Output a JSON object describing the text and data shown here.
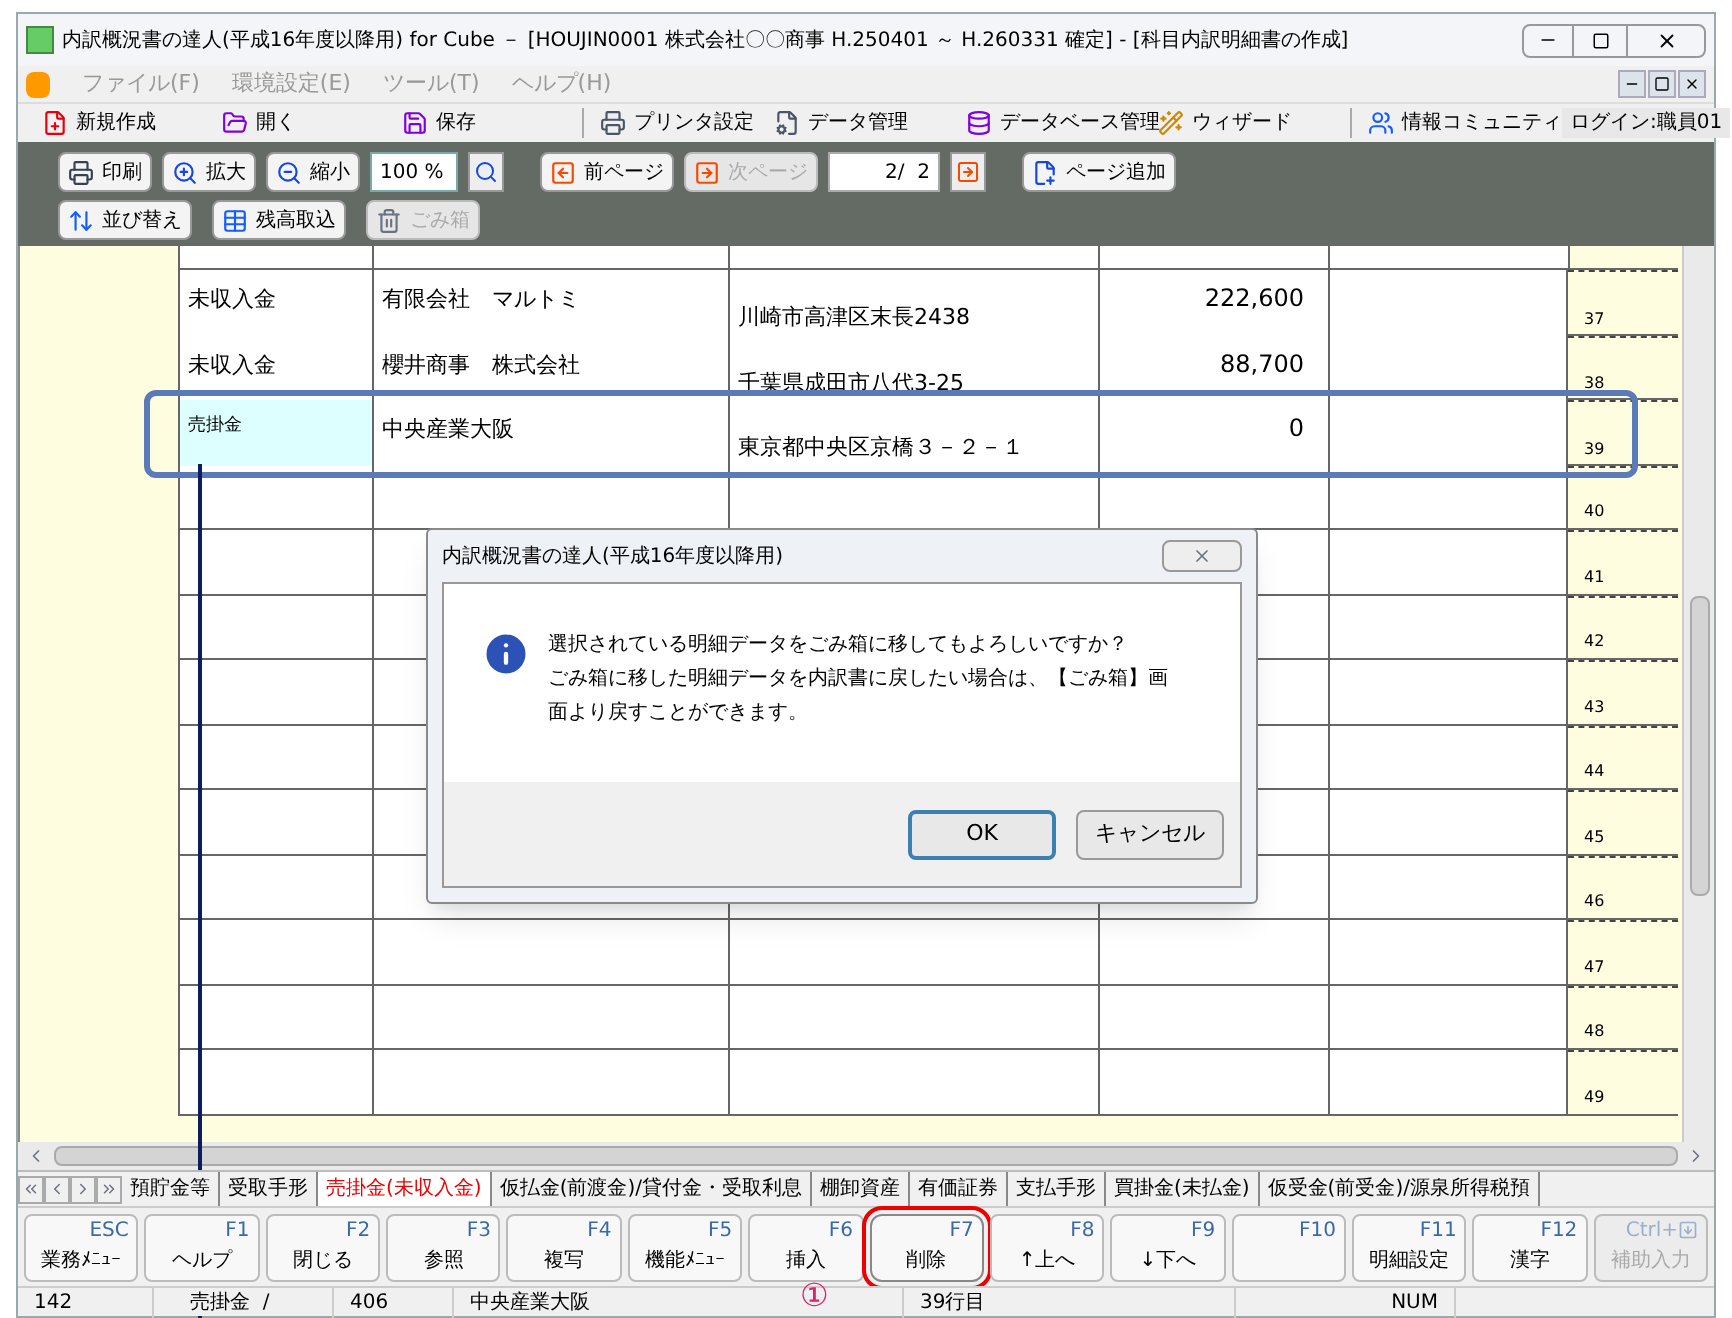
{
  "window": {
    "title": "内訳概況書の達人(平成16年度以降用) for Cube － [HOUJIN0001 株式会社〇〇商事 H.250401 ～ H.260331 確定] - [科目内訳明細書の作成]"
  },
  "menu": [
    "ファイル(F)",
    "環境設定(E)",
    "ツール(T)",
    "ヘルプ(H)"
  ],
  "toolbar": [
    {
      "label": "新規作成",
      "kind": "new"
    },
    {
      "label": "開く",
      "kind": "open"
    },
    {
      "label": "保存",
      "kind": "save"
    },
    {
      "label": "プリンタ設定",
      "kind": "printer"
    },
    {
      "label": "データ管理",
      "kind": "data"
    },
    {
      "label": "データベース管理",
      "kind": "database"
    },
    {
      "label": "ウィザード",
      "kind": "wizard"
    },
    {
      "label": "情報コミュニティ",
      "kind": "community"
    }
  ],
  "login": "ログイン:職員01",
  "preview_toolbar": {
    "row1": [
      {
        "label": "印刷",
        "kind": "print",
        "disabled": false
      },
      {
        "label": "拡大",
        "kind": "zoomin",
        "disabled": false
      },
      {
        "label": "縮小",
        "kind": "zoomout",
        "disabled": false
      }
    ],
    "zoom_value": "100 %",
    "page_buttons": [
      {
        "label": "前ページ",
        "kind": "prev",
        "disabled": false
      },
      {
        "label": "次ページ",
        "kind": "next",
        "disabled": true
      }
    ],
    "page_value": "2/  2",
    "add_page": "ページ追加",
    "row2": [
      {
        "label": "並び替え",
        "kind": "sort",
        "disabled": false
      },
      {
        "label": "残高取込",
        "kind": "import",
        "disabled": false
      },
      {
        "label": "ごみ箱",
        "kind": "trash",
        "disabled": true
      }
    ]
  },
  "table": {
    "rows": [
      {
        "number": "37",
        "account": "未収入金",
        "name": "有限会社　マルトミ",
        "address": "川崎市高津区末長2438",
        "amount": "222,600",
        "selected": false
      },
      {
        "number": "38",
        "account": "未収入金",
        "name": "櫻井商事　株式会社",
        "address": "千葉県成田市八代3-25",
        "amount": "88,700",
        "selected": false
      },
      {
        "number": "39",
        "account": "売掛金",
        "name": "中央産業大阪",
        "address": "東京都中央区京橋３－２－１",
        "amount": "0",
        "selected": true
      },
      {
        "number": "40"
      },
      {
        "number": "41"
      },
      {
        "number": "42"
      },
      {
        "number": "43"
      },
      {
        "number": "44"
      },
      {
        "number": "45"
      },
      {
        "number": "46"
      },
      {
        "number": "47"
      },
      {
        "number": "48"
      },
      {
        "number": "49"
      }
    ]
  },
  "dialog": {
    "title": "内訳概況書の達人(平成16年度以降用)",
    "message": [
      "選択されている明細データをごみ箱に移してもよろしいですか？",
      "ごみ箱に移した明細データを内訳書に戻したい場合は、【ごみ箱】画",
      "面より戻すことができます。"
    ],
    "buttons": [
      {
        "label": "OK",
        "selected": true
      },
      {
        "label": "キャンセル",
        "selected": false
      }
    ]
  },
  "sheet_tabs": [
    {
      "label": "預貯金等",
      "selected": false
    },
    {
      "label": "受取手形",
      "selected": false
    },
    {
      "label": "売掛金(未収入金)",
      "selected": true
    },
    {
      "label": "仮払金(前渡金)/貸付金・受取利息",
      "selected": false
    },
    {
      "label": "棚卸資産",
      "selected": false
    },
    {
      "label": "有価証券",
      "selected": false
    },
    {
      "label": "支払手形",
      "selected": false
    },
    {
      "label": "買掛金(未払金)",
      "selected": false
    },
    {
      "label": "仮受金(前受金)/源泉所得税預",
      "selected": false
    }
  ],
  "function_keys": [
    {
      "key": "ESC",
      "label": "業務ﾒﾆｭｰ",
      "disabled": false,
      "selected": false
    },
    {
      "key": "F1",
      "label": "ヘルプ",
      "disabled": false,
      "selected": false
    },
    {
      "key": "F2",
      "label": "閉じる",
      "disabled": false,
      "selected": false
    },
    {
      "key": "F3",
      "label": "参照",
      "disabled": false,
      "selected": false
    },
    {
      "key": "F4",
      "label": "複写",
      "disabled": false,
      "selected": false
    },
    {
      "key": "F5",
      "label": "機能ﾒﾆｭｰ",
      "disabled": false,
      "selected": false
    },
    {
      "key": "F6",
      "label": "挿入",
      "disabled": false,
      "selected": false
    },
    {
      "key": "F7",
      "label": "削除",
      "disabled": false,
      "selected": true
    },
    {
      "key": "F8",
      "label": "↑上へ",
      "disabled": false,
      "selected": false
    },
    {
      "key": "F9",
      "label": "↓下へ",
      "disabled": false,
      "selected": false
    },
    {
      "key": "F10",
      "disabled": false,
      "selected": false
    },
    {
      "key": "F11",
      "label": "明細設定",
      "disabled": false,
      "selected": false
    },
    {
      "key": "F12",
      "label": "漢字",
      "disabled": false,
      "selected": false
    },
    {
      "key": "Ctrl+",
      "label": "補助入力",
      "disabled": true,
      "selected": false
    }
  ],
  "annotation": "①",
  "status_bar": [
    "142",
    "売掛金  /",
    "406",
    "中央産業大阪",
    "39行目",
    "NUM"
  ]
}
